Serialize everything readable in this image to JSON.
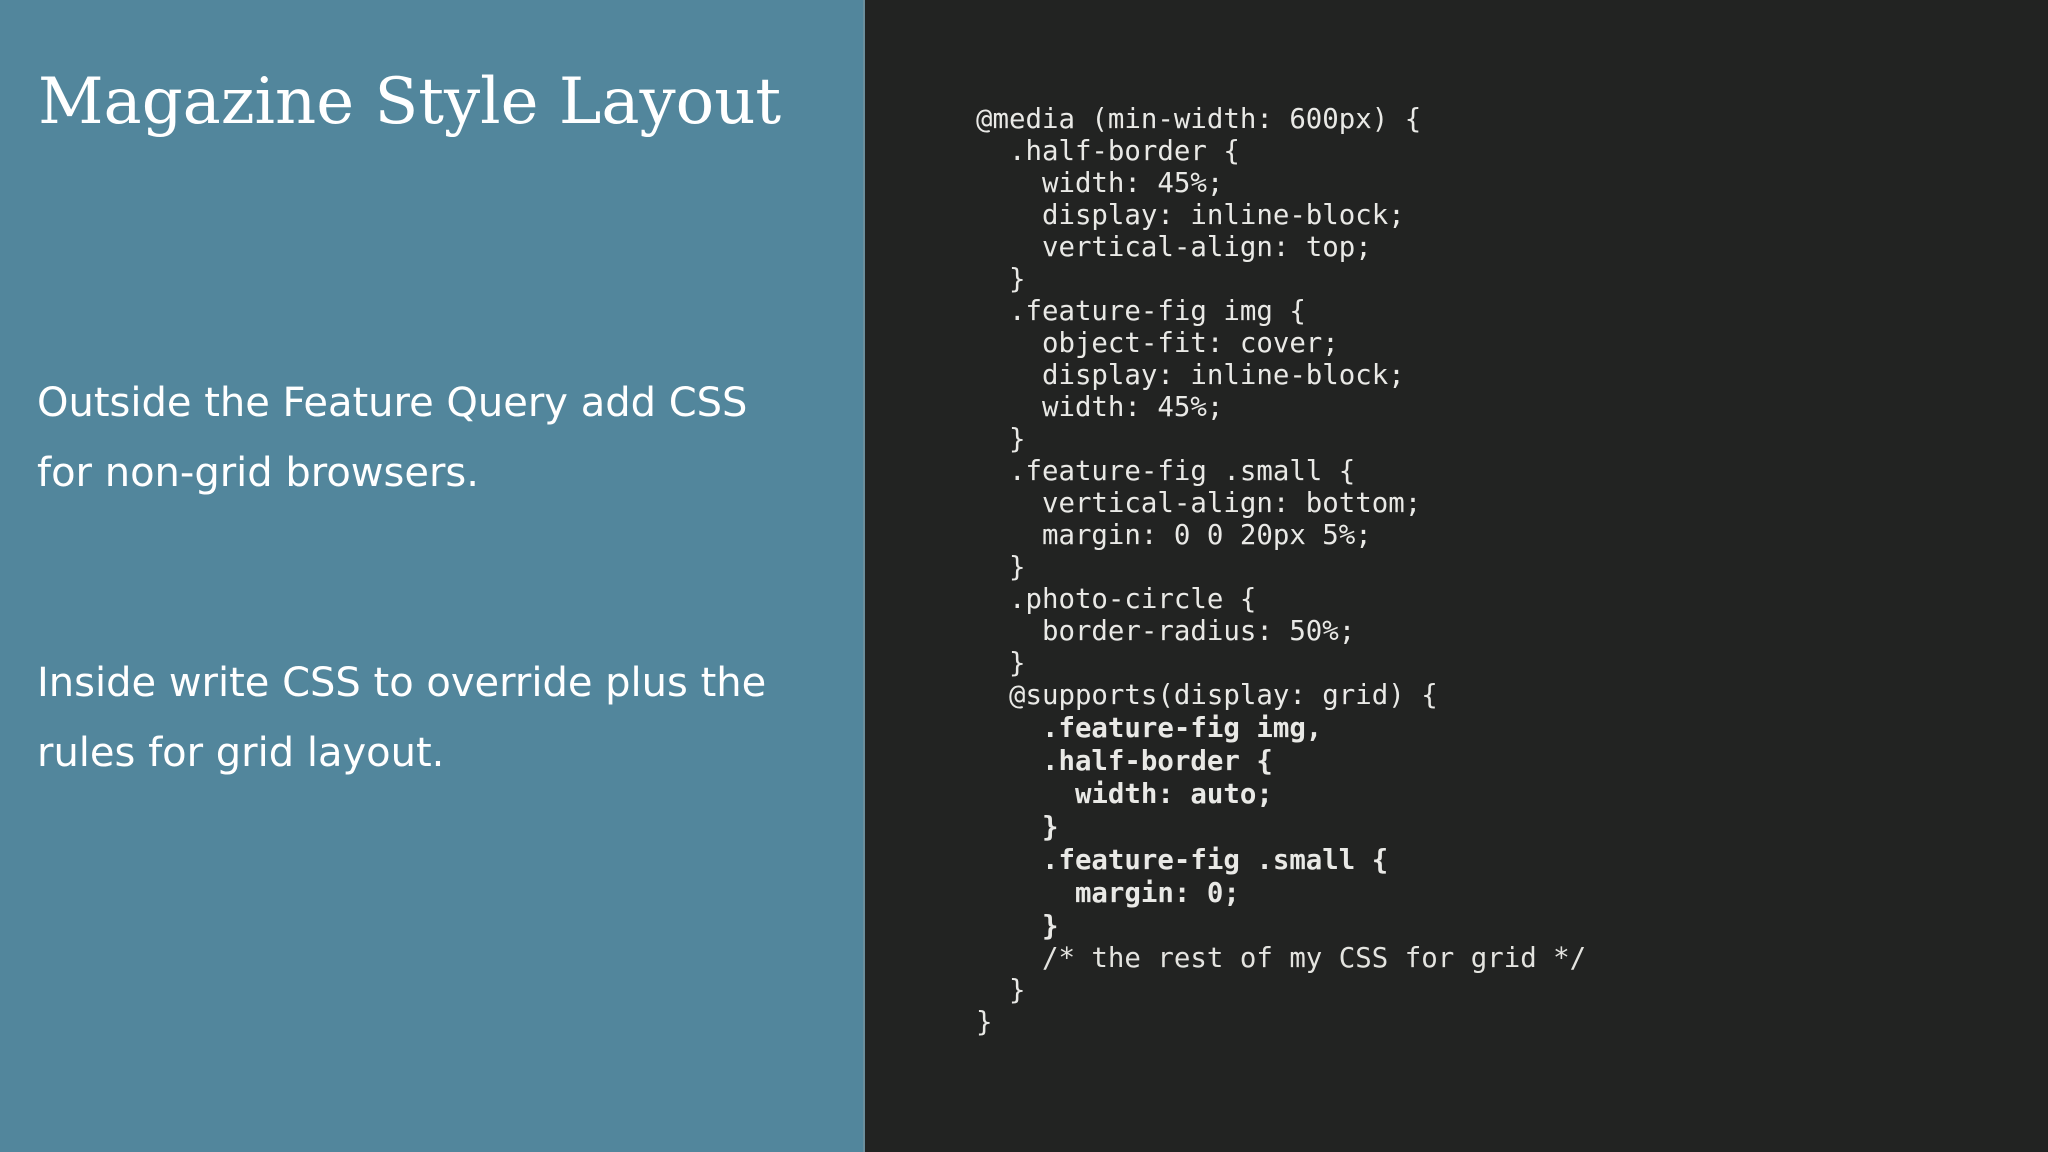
{
  "slide": {
    "title": "Magazine Style Layout",
    "paragraphs": [
      {
        "lines": [
          "Outside the Feature Query add CSS",
          "for non-grid browsers."
        ]
      },
      {
        "lines": [
          "Inside write CSS to override plus the",
          "rules for grid layout."
        ]
      }
    ],
    "colors": {
      "left_panel": "#52869c",
      "right_panel": "#222322",
      "title_text": "#ffffff",
      "code_text": "#e9e9e6"
    }
  },
  "code": {
    "language": "css",
    "lines": [
      {
        "text": "@media (min-width: 600px) {",
        "bold": false
      },
      {
        "text": "  .half-border {",
        "bold": false
      },
      {
        "text": "    width: 45%;",
        "bold": false
      },
      {
        "text": "    display: inline-block;",
        "bold": false
      },
      {
        "text": "    vertical-align: top;",
        "bold": false
      },
      {
        "text": "  }",
        "bold": false
      },
      {
        "text": "  .feature-fig img {",
        "bold": false
      },
      {
        "text": "    object-fit: cover;",
        "bold": false
      },
      {
        "text": "    display: inline-block;",
        "bold": false
      },
      {
        "text": "    width: 45%;",
        "bold": false
      },
      {
        "text": "  }",
        "bold": false
      },
      {
        "text": "  .feature-fig .small {",
        "bold": false
      },
      {
        "text": "    vertical-align: bottom;",
        "bold": false
      },
      {
        "text": "    margin: 0 0 20px 5%;",
        "bold": false
      },
      {
        "text": "  }",
        "bold": false
      },
      {
        "text": "  .photo-circle {",
        "bold": false
      },
      {
        "text": "    border-radius: 50%;",
        "bold": false
      },
      {
        "text": "  }",
        "bold": false
      },
      {
        "text": "  @supports(display: grid) {",
        "bold": false
      },
      {
        "text": "    .feature-fig img,",
        "bold": true
      },
      {
        "text": "    .half-border {",
        "bold": true
      },
      {
        "text": "      width: auto;",
        "bold": true
      },
      {
        "text": "    }",
        "bold": true
      },
      {
        "text": "    .feature-fig .small {",
        "bold": true
      },
      {
        "text": "      margin: 0;",
        "bold": true
      },
      {
        "text": "    }",
        "bold": true
      },
      {
        "text": "    /* the rest of my CSS for grid */",
        "bold": false,
        "comment": true
      },
      {
        "text": "  }",
        "bold": false
      },
      {
        "text": "}",
        "bold": false
      }
    ]
  }
}
